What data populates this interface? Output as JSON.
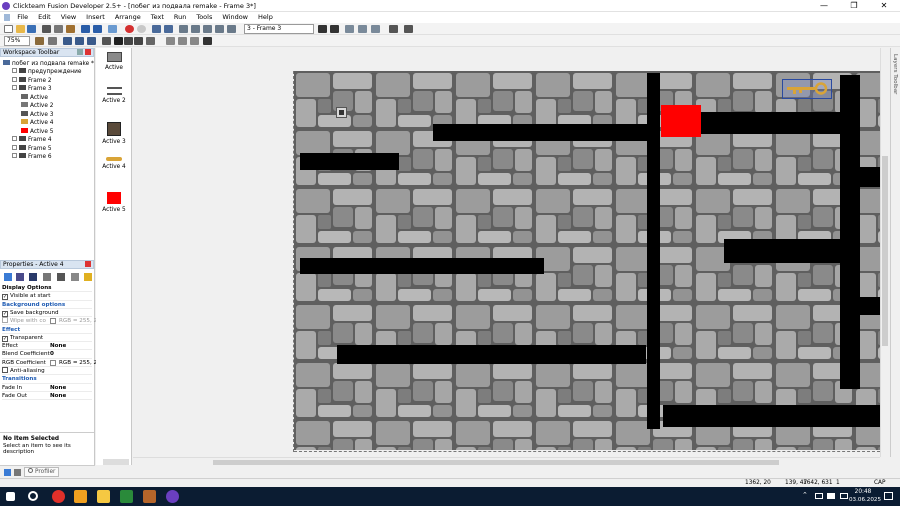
{
  "window": {
    "title": "Clickteam Fusion Developer 2.5+ - [побег из подвала remake - Frame 3*]",
    "min": "—",
    "max": "❐",
    "close": "✕"
  },
  "menu": [
    "File",
    "Edit",
    "View",
    "Insert",
    "Arrange",
    "Text",
    "Run",
    "Tools",
    "Window",
    "Help"
  ],
  "toolbar": {
    "frame_select": "3 - Frame 3",
    "zoom": "75%"
  },
  "workspace": {
    "title": "Workspace Toolbar",
    "items": [
      {
        "label": "побег из подвала remake *",
        "level": 0
      },
      {
        "label": "предупреждение",
        "level": 1
      },
      {
        "label": "Frame 2",
        "level": 1
      },
      {
        "label": "Frame 3",
        "level": 1
      },
      {
        "label": "Active",
        "level": 2
      },
      {
        "label": "Active 2",
        "level": 2
      },
      {
        "label": "Active 3",
        "level": 2
      },
      {
        "label": "Active 4",
        "level": 2
      },
      {
        "label": "Active 5",
        "level": 2
      },
      {
        "label": "Frame 4",
        "level": 1
      },
      {
        "label": "Frame 5",
        "level": 1
      },
      {
        "label": "Frame 6",
        "level": 1
      }
    ]
  },
  "properties": {
    "title": "Properties - Active 4",
    "rows": [
      {
        "label": "Display Options",
        "kind": "header"
      },
      {
        "label": "Visible at start",
        "kind": "check",
        "checked": true
      },
      {
        "label": "Background options",
        "kind": "section"
      },
      {
        "label": "Save background",
        "kind": "check",
        "checked": true
      },
      {
        "label": "Wipe with co",
        "kind": "check-disabled",
        "value": "RGB = 255, 2"
      },
      {
        "label": "Effect",
        "kind": "section"
      },
      {
        "label": "Transparent",
        "kind": "check",
        "checked": true
      },
      {
        "label": "Effect",
        "kind": "value",
        "value": "None"
      },
      {
        "label": "Blend Coefficient",
        "kind": "value",
        "value": "0"
      },
      {
        "label": "RGB Coefficient",
        "kind": "color",
        "value": "RGB = 255, 2"
      },
      {
        "label": "Anti-aliasing",
        "kind": "check",
        "checked": false
      },
      {
        "label": "Transitions",
        "kind": "section"
      },
      {
        "label": "Fade In",
        "kind": "value",
        "value": "None"
      },
      {
        "label": "Fade Out",
        "kind": "value",
        "value": "None"
      }
    ],
    "info_title": "No Item Selected",
    "info_desc": "Select an item to see its description"
  },
  "profiler_tab": "Profiler",
  "palette": [
    {
      "label": "Active",
      "icon": "gray-block-icon"
    },
    {
      "label": "Active 2",
      "icon": "ladder-icon"
    },
    {
      "label": "Active 3",
      "icon": "portrait-icon"
    },
    {
      "label": "Active 4",
      "icon": "key-icon"
    },
    {
      "label": "Active 5",
      "icon": "red-square-icon"
    }
  ],
  "layers_toolbar": "Layers Toolbar",
  "status": {
    "coord1": "1362, 20",
    "coord2": "139, 47",
    "coord3": "1642, 631",
    "layer": "1",
    "capnum": "CAP NUM"
  },
  "clock": {
    "time": "20:48",
    "date": "03.06.2025"
  },
  "colors": {
    "wall": "#000000",
    "red_block": "#ff0000",
    "taskbar": "#0b1c32",
    "panel_header": "#d9e4f1",
    "section_text": "#1e5bb3"
  }
}
